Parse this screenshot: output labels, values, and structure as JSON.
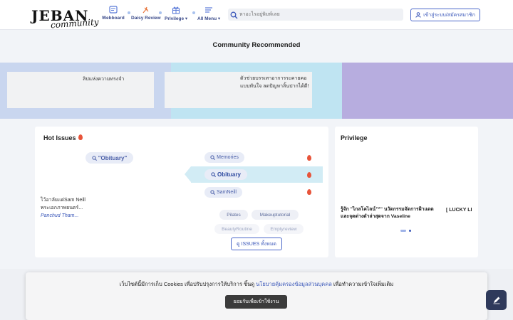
{
  "header": {
    "logo": "JEBAN",
    "logo_sub": "community",
    "nav": [
      {
        "label": "Webboard",
        "icon": "webboard-icon"
      },
      {
        "label": "Daisy Review",
        "icon": "daisy-review-icon"
      },
      {
        "label": "Privilege ▾",
        "icon": "gift-icon"
      },
      {
        "label": "All Menu ▾",
        "icon": "menu-icon"
      }
    ],
    "search_placeholder": "หาอะไรอยู่พิมพ์เลย",
    "login_label": "เข้าสู่ระบบ/สมัครสมาชิก"
  },
  "recommended": {
    "title": "Community Recommended",
    "cards": [
      {
        "text": "ลิปแห่งความทรงจำ"
      },
      {
        "text": "ตัวช่วยบรรเทาอาการระคายคอ แบบทันใจ ลดปัญหาลิ้นปากได้ดี!"
      }
    ]
  },
  "hot_issues": {
    "title": "Hot Issues",
    "featured_query": "\"Obituary\"",
    "post_text": "ไว้อาลัยแด่Sam Neill พระเอกภาพยนตร์...",
    "post_author": "Panchud Tham...",
    "ranked": [
      {
        "label": "Memories"
      },
      {
        "label": "Obituary"
      },
      {
        "label": "SamNeill"
      }
    ],
    "tags": [
      "Pilates",
      "Makeuptutorial",
      "BeautyRoutine",
      "Emptyreview"
    ],
    "all_label": "ดู ISSUES ทั้งหมด"
  },
  "privilege": {
    "title": "Privilege",
    "item_text": "รู้จัก \"ไกลโคไลน์™\" นวัตกรรมจัดการฝ้าแดด และจุดด่างดำล่าสุดจาก Vaseline",
    "item_side": "[ LUCKY LI"
  },
  "cookie": {
    "text_before": "เว็บไซต์นี้มีการเก็บ Cookies เพื่อปรับปรุงการให้บริการ ชิ้นดู ",
    "link": "นโยบายคุ้มครองข้อมูลส่วนบุคคล",
    "text_after": " เพื่อทำความเข้าใจเพิ่มเติม",
    "button": "ยอมรับเพื่อเข้าใช้งาน"
  },
  "colors": {
    "accent": "#3a57b9",
    "banner_blue": "#c9d6ef",
    "banner_cyan": "#bfe4f2",
    "banner_purple": "#b7addf",
    "fire": "#e8543a"
  }
}
